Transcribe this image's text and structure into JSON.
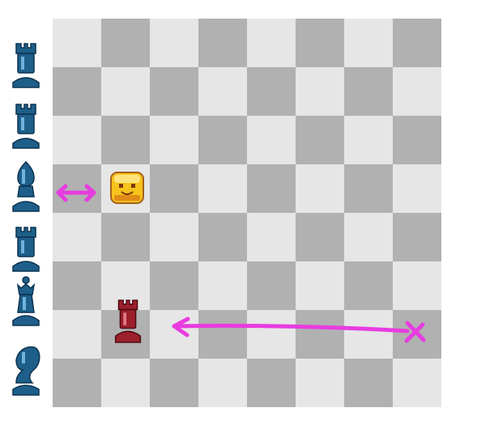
{
  "board": {
    "files": 8,
    "ranks": 8,
    "light_color": "#e6e6e6",
    "dark_color": "#b1b1b1",
    "top_left_square": "light"
  },
  "sidebar": {
    "pieces": [
      {
        "type": "rook",
        "color": "blue",
        "icon": "blue-rook-icon"
      },
      {
        "type": "rook",
        "color": "blue",
        "icon": "blue-rook-icon"
      },
      {
        "type": "bishop",
        "color": "blue",
        "icon": "blue-bishop-icon"
      },
      {
        "type": "rook",
        "color": "blue",
        "icon": "blue-rook-icon"
      },
      {
        "type": "queen",
        "color": "blue",
        "icon": "blue-queen-icon"
      },
      {
        "type": "knight",
        "color": "blue",
        "icon": "blue-knight-icon"
      }
    ]
  },
  "pieces_on_board": [
    {
      "type": "rook",
      "color": "red",
      "icon": "red-rook-icon",
      "file": 2,
      "rank": 7
    },
    {
      "type": "yellow-character",
      "icon": "yellow-block-character-icon",
      "file": 2,
      "rank": 4
    }
  ],
  "annotations": [
    {
      "kind": "double-arrow",
      "color": "#e83ce0",
      "icon": "double-headed-arrow"
    },
    {
      "kind": "arrow-with-x",
      "color": "#e83ce0",
      "icon": "left-arrow-with-x-mark"
    }
  ],
  "colors": {
    "blue_piece": "#1e5f8a",
    "red_piece": "#9c1f2b",
    "yellow_piece": "#f6c21c",
    "annotation": "#e83ce0"
  }
}
